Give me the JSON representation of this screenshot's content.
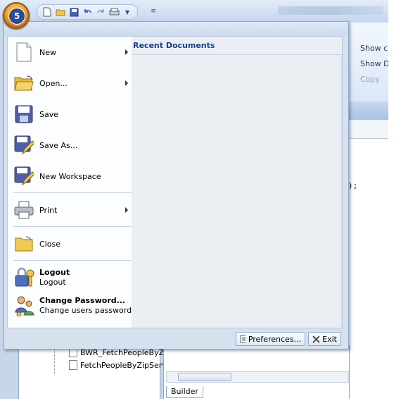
{
  "app": {
    "orb_label": "5",
    "title_bar": ""
  },
  "quick_access": {
    "icons": [
      "new-doc-icon",
      "open-folder-icon",
      "save-icon",
      "undo-icon",
      "redo-icon",
      "print-icon",
      "dropdown-icon",
      "customize-icon"
    ]
  },
  "ribbon": {
    "show_1": "Show c",
    "show_2": "Show De",
    "copy": "Copy"
  },
  "code": {
    "fragment": ");"
  },
  "tree": {
    "items": [
      "BWR_FetchPeopleByZ",
      "FetchPeopleByZipServ"
    ]
  },
  "tabs": {
    "builder": "Builder"
  },
  "menu": {
    "items": [
      {
        "label": "New",
        "has_submenu": true
      },
      {
        "label": "Open...",
        "has_submenu": true
      },
      {
        "label": "Save",
        "has_submenu": false
      },
      {
        "label": "Save As...",
        "has_submenu": false
      },
      {
        "label": "New Workspace",
        "has_submenu": false
      },
      {
        "label": "Print",
        "has_submenu": true
      },
      {
        "label": "Close",
        "has_submenu": false
      }
    ],
    "logout": {
      "title": "Logout",
      "subtitle": "Logout"
    },
    "change_password": {
      "title": "Change Password...",
      "subtitle": "Change users password"
    },
    "recent_title": "Recent Documents",
    "preferences": "Preferences...",
    "exit": "Exit"
  }
}
